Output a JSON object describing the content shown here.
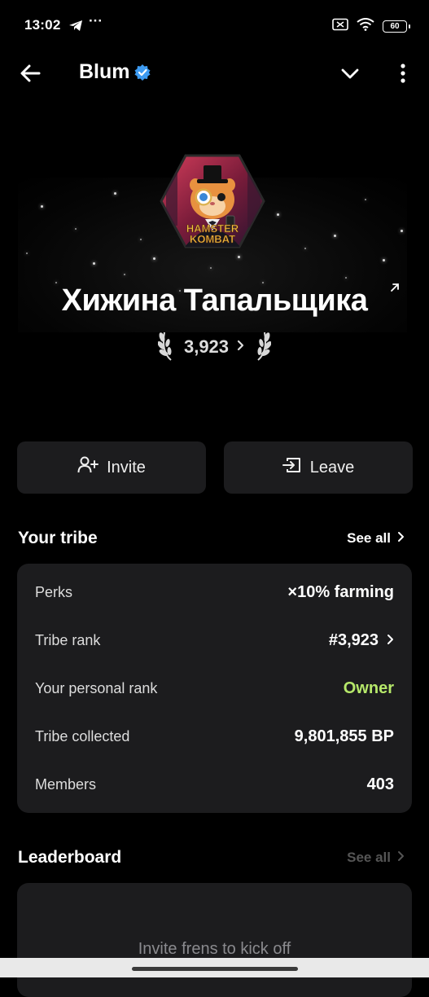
{
  "status_bar": {
    "time": "13:02",
    "more": "···",
    "battery": "60"
  },
  "header": {
    "title": "Blum"
  },
  "tribe": {
    "name": "Хижина Тапальщика",
    "rank": "3,923",
    "avatar_text_1": "HAMSTER",
    "avatar_text_2": "KOMBAT"
  },
  "actions": {
    "invite": "Invite",
    "leave": "Leave"
  },
  "your_tribe": {
    "title": "Your tribe",
    "see_all": "See all",
    "rows": [
      {
        "label": "Perks",
        "value": "×10% farming"
      },
      {
        "label": "Tribe rank",
        "value": "#3,923"
      },
      {
        "label": "Your personal rank",
        "value": "Owner"
      },
      {
        "label": "Tribe collected",
        "value": "9,801,855 BP"
      },
      {
        "label": "Members",
        "value": "403"
      }
    ]
  },
  "leaderboard": {
    "title": "Leaderboard",
    "see_all": "See all",
    "empty_text": "Invite frens to kick off"
  },
  "colors": {
    "card": "#1c1c1e",
    "accent_owner": "#b6e86a",
    "verified": "#3d9bf2"
  }
}
